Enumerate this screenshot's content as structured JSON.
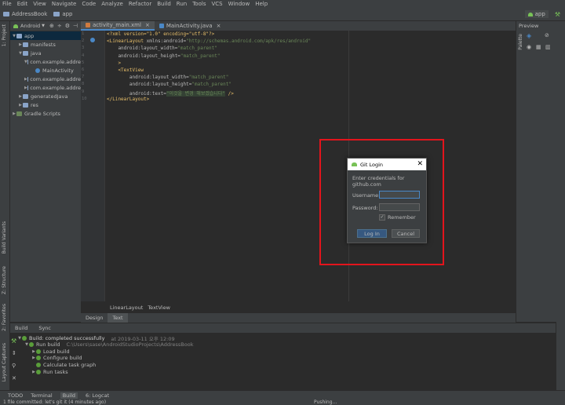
{
  "menu": [
    "File",
    "Edit",
    "View",
    "Navigate",
    "Code",
    "Analyze",
    "Refactor",
    "Build",
    "Run",
    "Tools",
    "VCS",
    "Window",
    "Help"
  ],
  "nav": {
    "project": "AddressBook",
    "module": "app",
    "run_config": "app"
  },
  "left_tools": {
    "project": "1: Project",
    "build_variants": "Build Variants",
    "structure": "Z: Structure",
    "favorites": "2: Favorites",
    "layout_captures": "Layout Captures"
  },
  "project_panel": {
    "view": "Android"
  },
  "tree": [
    {
      "label": "app",
      "level": 0,
      "icon": "folder",
      "arrow": "down",
      "selected": true
    },
    {
      "label": "manifests",
      "level": 1,
      "icon": "folder",
      "arrow": "right"
    },
    {
      "label": "java",
      "level": 1,
      "icon": "folder",
      "arrow": "down"
    },
    {
      "label": "com.example.addre",
      "level": 2,
      "icon": "package",
      "arrow": "down"
    },
    {
      "label": "MainActivity",
      "level": 3,
      "icon": "class",
      "arrow": ""
    },
    {
      "label": "com.example.addre",
      "level": 2,
      "icon": "package",
      "arrow": "right"
    },
    {
      "label": "com.example.addre",
      "level": 2,
      "icon": "package",
      "arrow": "right"
    },
    {
      "label": "generatedJava",
      "level": 1,
      "icon": "folder",
      "arrow": "right"
    },
    {
      "label": "res",
      "level": 1,
      "icon": "folder",
      "arrow": "right"
    },
    {
      "label": "Gradle Scripts",
      "level": 0,
      "icon": "gradle",
      "arrow": "right"
    }
  ],
  "tabs": [
    {
      "label": "activity_main.xml",
      "active": true
    },
    {
      "label": "MainActivity.java",
      "active": false
    }
  ],
  "code_lines": [
    {
      "n": "1",
      "parts": [
        [
          "tag",
          "<?xml version=\"1.0\" encoding=\"utf-8\"?>"
        ]
      ]
    },
    {
      "n": "2",
      "parts": [
        [
          "tag",
          "<LinearLayout "
        ],
        [
          "attr",
          "xmlns:android="
        ],
        [
          "val",
          "\"http://schemas.android.com/apk/res/android\""
        ]
      ]
    },
    {
      "n": "3",
      "parts": [
        [
          "attr",
          "    android:layout_width="
        ],
        [
          "val",
          "\"match_parent\""
        ]
      ]
    },
    {
      "n": "4",
      "parts": [
        [
          "attr",
          "    android:layout_height="
        ],
        [
          "val",
          "\"match_parent\""
        ]
      ]
    },
    {
      "n": "5",
      "parts": [
        [
          "tag",
          "    >"
        ]
      ]
    },
    {
      "n": "6",
      "parts": [
        [
          "tag",
          "    <TextView"
        ]
      ]
    },
    {
      "n": "7",
      "parts": [
        [
          "attr",
          "        android:layout_width="
        ],
        [
          "val",
          "\"match_parent\""
        ]
      ]
    },
    {
      "n": "8",
      "parts": [
        [
          "attr",
          "        android:layout_height="
        ],
        [
          "val",
          "\"match_parent\""
        ]
      ]
    },
    {
      "n": "9",
      "parts": [
        [
          "attr",
          "        android:text="
        ],
        [
          "hl",
          "\"이것을 변경 해보겠습니다\""
        ],
        [
          "tag",
          " />"
        ]
      ]
    },
    {
      "n": "10",
      "parts": [
        [
          "tag",
          "</LinearLayout>"
        ]
      ]
    }
  ],
  "editor_breadcrumb": [
    "LinearLayout",
    "TextView"
  ],
  "design_tabs": [
    {
      "label": "Design",
      "active": false
    },
    {
      "label": "Text",
      "active": true
    }
  ],
  "palette": {
    "preview": "Preview",
    "palette": "Palette"
  },
  "build": {
    "tabs": [
      "Build",
      "Sync"
    ],
    "rows": [
      {
        "indent": 0,
        "text": "Build: completed successfully",
        "meta": "at 2019-03-11 오후 12:09",
        "arrow": "down",
        "bold": true
      },
      {
        "indent": 1,
        "text": "Run build",
        "meta": "C:\\Users\\sase\\AndroidStudioProjects\\AddressBook",
        "arrow": "down"
      },
      {
        "indent": 2,
        "text": "Load build",
        "meta": "",
        "arrow": "right"
      },
      {
        "indent": 2,
        "text": "Configure build",
        "meta": "",
        "arrow": "right"
      },
      {
        "indent": 2,
        "text": "Calculate task graph",
        "meta": "",
        "arrow": ""
      },
      {
        "indent": 2,
        "text": "Run tasks",
        "meta": "",
        "arrow": "right"
      }
    ]
  },
  "bottom_tabs": [
    "TODO",
    "Terminal",
    "Build",
    "6: Logcat"
  ],
  "status": {
    "left": "1 file committed: let's git it (4 minutes ago)",
    "right": "Pushing..."
  },
  "dialog": {
    "title": "Git Login",
    "message": "Enter credentials for github.com",
    "username_label": "Username:",
    "password_label": "Password:",
    "username_value": "",
    "password_value": "",
    "remember_label": "Remember",
    "remember_checked": true,
    "login_label": "Log In",
    "cancel_label": "Cancel"
  },
  "colors": {
    "accent": "#4a88c7",
    "highlight": "#e3141c",
    "success": "#5a9e3a"
  }
}
